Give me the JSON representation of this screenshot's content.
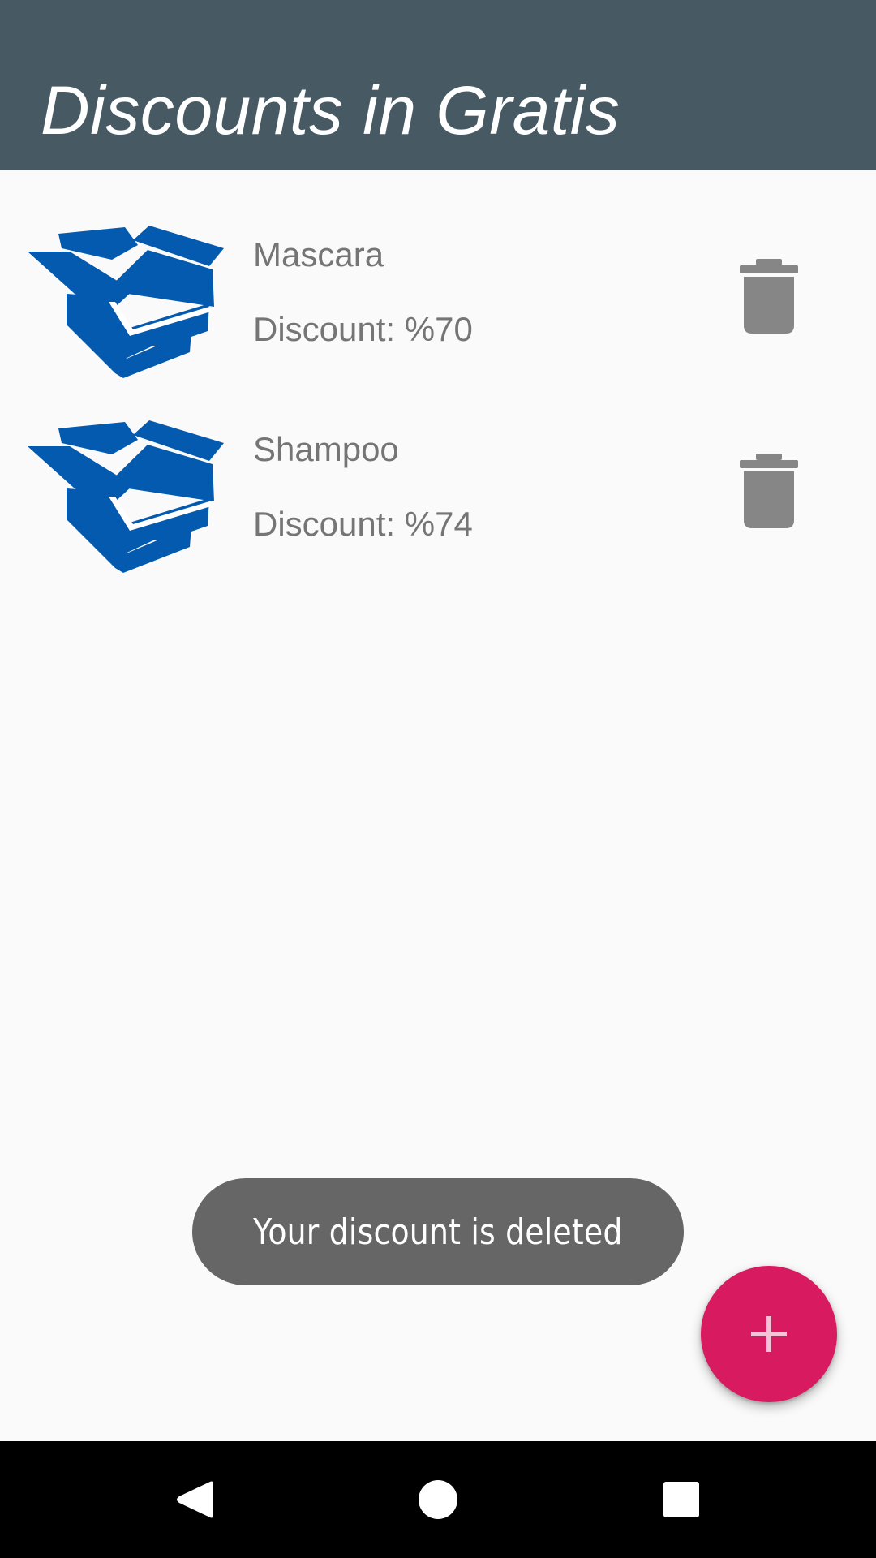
{
  "app_bar": {
    "title": "Discounts in Gratis",
    "background_color": "#475a64"
  },
  "discounts": [
    {
      "name": "Mascara",
      "discount_text": "Discount: %70",
      "icon": "open-box-icon"
    },
    {
      "name": "Shampoo",
      "discount_text": "Discount: %74",
      "icon": "open-box-icon"
    }
  ],
  "delete_icon": "trash-icon",
  "toast": {
    "message": "Your discount is deleted"
  },
  "fab": {
    "icon": "plus-icon",
    "color": "#d81b60"
  },
  "navigation": {
    "back_icon": "back-triangle-icon",
    "home_icon": "home-circle-icon",
    "recents_icon": "recents-square-icon"
  },
  "colors": {
    "icon_blue": "#035aae",
    "text_gray": "#757575",
    "toast_bg": "#666666",
    "trash_gray": "#868686"
  }
}
